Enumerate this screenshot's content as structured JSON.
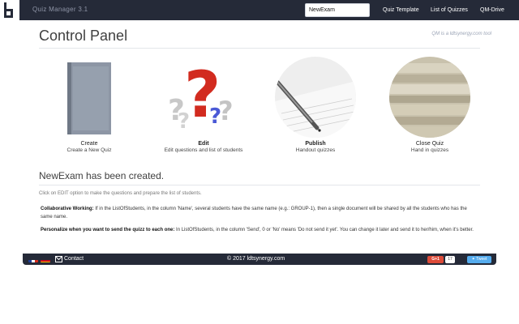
{
  "header": {
    "app_title": "Quiz Manager 3.1",
    "search_value": "NewExam",
    "nav": [
      "Quiz Template",
      "List of Quizzes",
      "QM-Drive"
    ]
  },
  "main": {
    "title": "Control Panel",
    "tagline": "QM is a ldtsynergy.com tool",
    "tiles": [
      {
        "label": "Create",
        "desc": "Create a New Quiz"
      },
      {
        "label": "Edit",
        "desc": "Edit questions and list of students"
      },
      {
        "label": "Publish",
        "desc": "Handout quizzes"
      },
      {
        "label": "Close Quiz",
        "desc": "Hand in quizzes"
      }
    ],
    "status": "NewExam has been created.",
    "hint": "Click on EDIT option to make the questions and prepare the list of students.",
    "notes": [
      {
        "title": "Collaborative Working:",
        "body": "If in the ListOfStudents, in the column 'Name', several students have the same name (e.g.: GROUP-1), then a single document will be shared by all the students who has the same name."
      },
      {
        "title": "Personalize when you want to send the quizz to each one:",
        "body": "In ListOfStudents, in the column 'Send', 0 or 'No' means 'Do not send it yet'. You can change it later and send it to her/him, when it's better."
      }
    ]
  },
  "footer": {
    "contact": "Contact",
    "copyright": "© 2017 ldtsynergy.com",
    "gplus_label": "G+1",
    "gplus_count": "17",
    "tweet_label": "Tweet"
  },
  "colors": {
    "topbar": "#252a38",
    "gplus": "#dd4b39",
    "tweet": "#55acee"
  }
}
